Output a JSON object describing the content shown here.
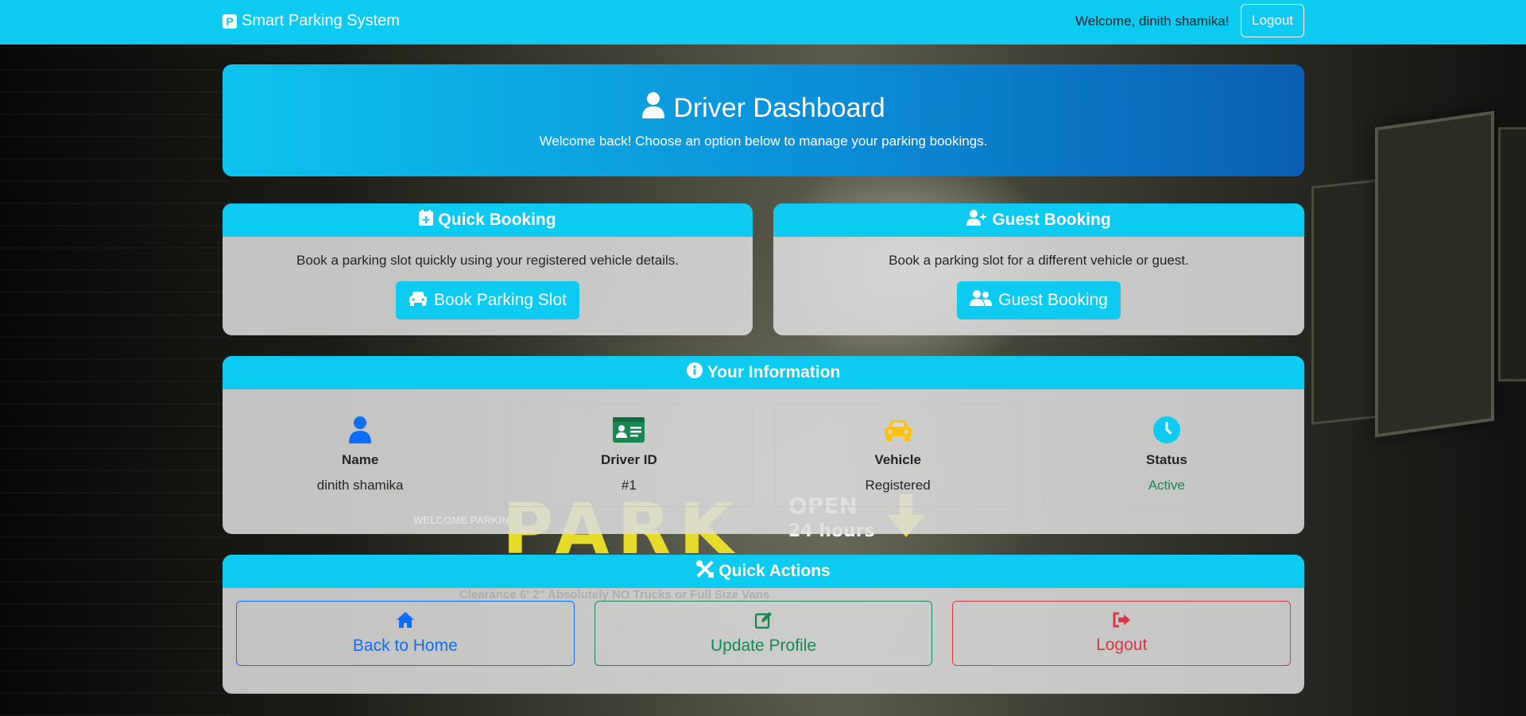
{
  "navbar": {
    "brand": "Smart Parking System",
    "welcome": "Welcome, dinith shamika!",
    "logout": "Logout"
  },
  "hero": {
    "title": "Driver Dashboard",
    "subtitle": "Welcome back! Choose an option below to manage your parking bookings."
  },
  "quick_booking": {
    "title": "Quick Booking",
    "text": "Book a parking slot quickly using your registered vehicle details.",
    "button": "Book Parking Slot"
  },
  "guest_booking": {
    "title": "Guest Booking",
    "text": "Book a parking slot for a different vehicle or guest.",
    "button": "Guest Booking"
  },
  "info": {
    "title": "Your Information",
    "items": [
      {
        "label": "Name",
        "value": "dinith shamika",
        "icon": "user-icon",
        "color": "#0d6efd"
      },
      {
        "label": "Driver ID",
        "value": "#1",
        "icon": "id-card-icon",
        "color": "#198754"
      },
      {
        "label": "Vehicle",
        "value": "Registered",
        "icon": "car-icon",
        "color": "#ffc107"
      },
      {
        "label": "Status",
        "value": "Active",
        "icon": "clock-icon",
        "color": "#0dcaf0"
      }
    ]
  },
  "actions": {
    "title": "Quick Actions",
    "home": "Back to Home",
    "profile": "Update Profile",
    "logout": "Logout"
  },
  "background_sign": {
    "welcome": "WELCOME PARKING",
    "park": "PARK",
    "open": "OPEN",
    "hours": "24 hours",
    "clearance": "Clearance 6' 2\"  Absolutely NO Trucks or Full Size Vans"
  },
  "colors": {
    "info": "#0dcaf0",
    "primary": "#0d6efd",
    "success": "#198754",
    "danger": "#dc3545",
    "warning": "#ffc107"
  }
}
